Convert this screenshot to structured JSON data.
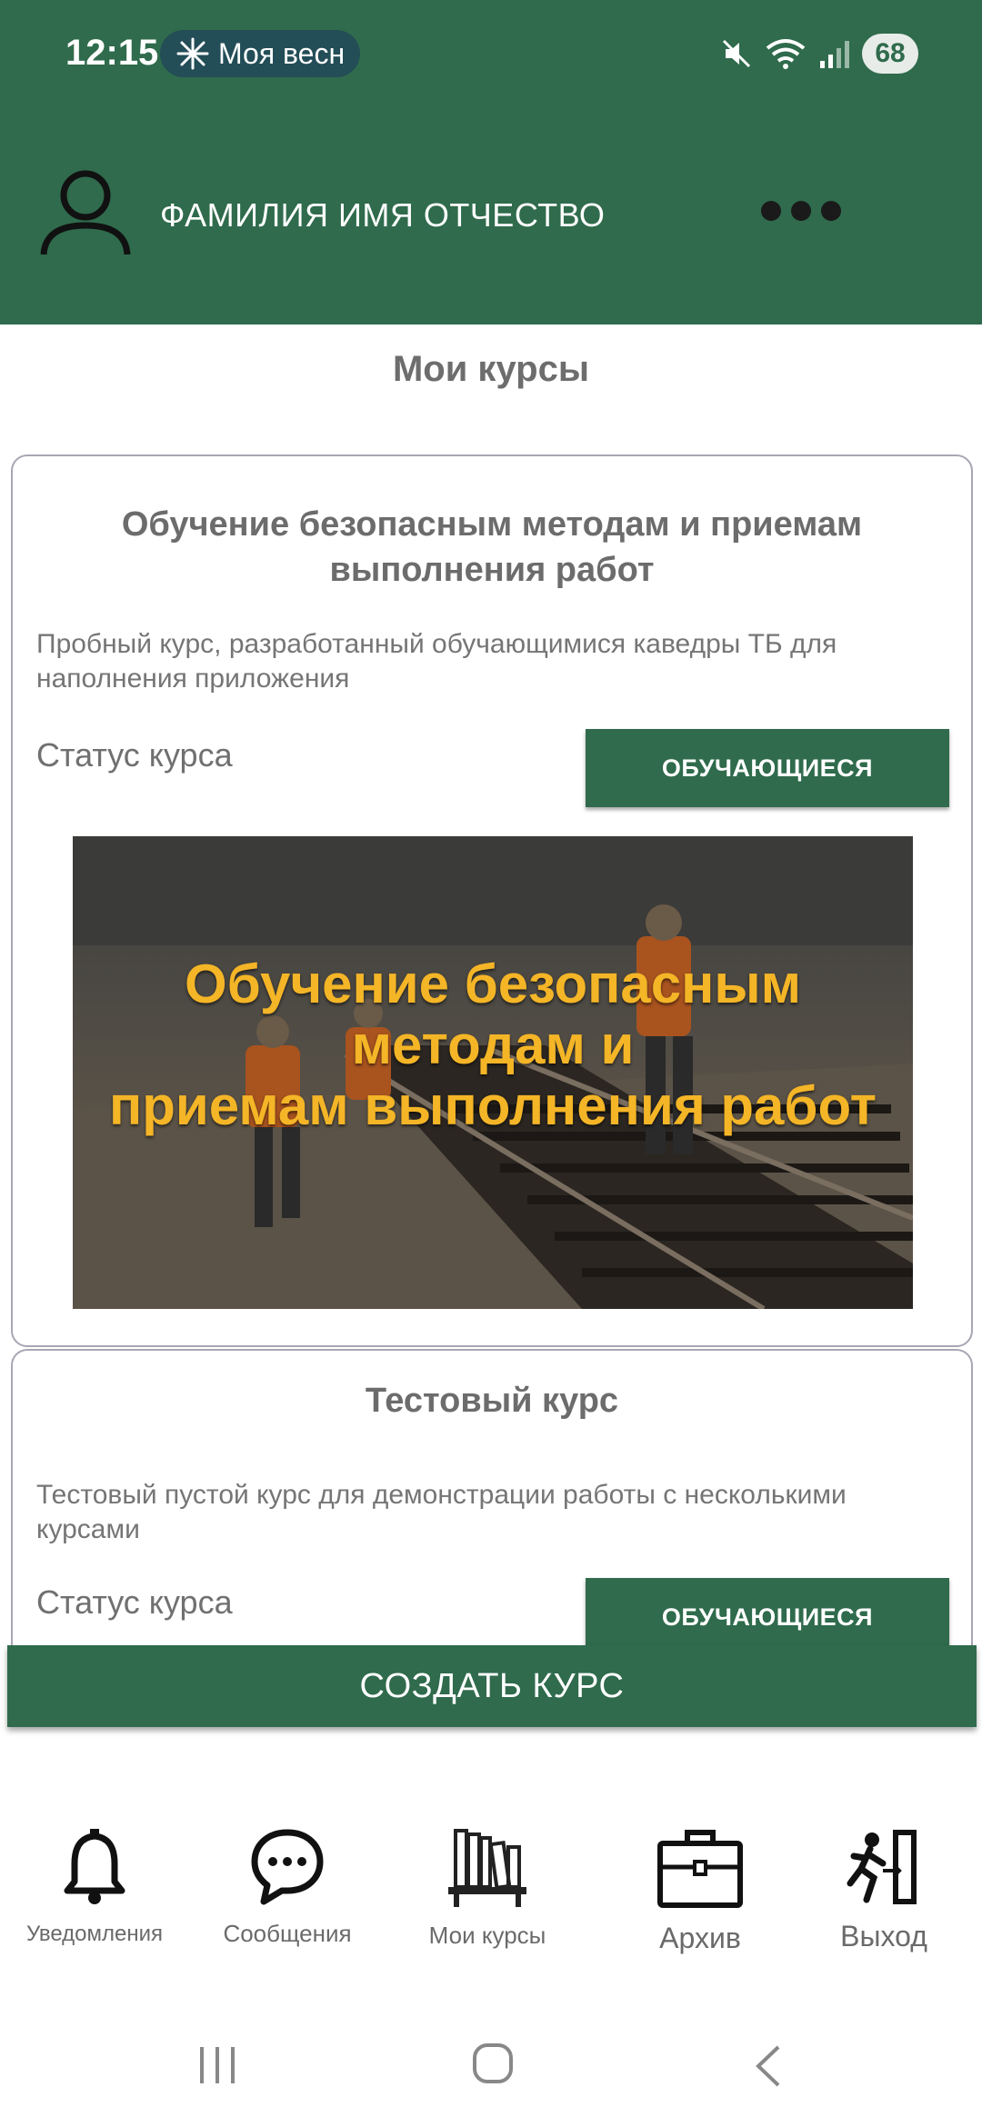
{
  "status_bar": {
    "time": "12:15",
    "notification_text": "Моя весн",
    "battery": "68"
  },
  "header": {
    "user_name": "ФАМИЛИЯ ИМЯ ОТЧЕСТВО"
  },
  "page": {
    "title": "Мои курсы"
  },
  "courses": [
    {
      "title": "Обучение безопасным методам и приемам выполнения работ",
      "description": "Пробный курс, разработанный обучающимися каведры ТБ для наполнения приложения",
      "status_label": "Статус курса",
      "status_button": "ОБУЧАЮЩИЕСЯ",
      "image_text": [
        "Обучение безопасным",
        "методам и",
        "приемам выполнения работ"
      ]
    },
    {
      "title": "Тестовый курс",
      "description": "Тестовый пустой курс для демонстрации работы с несколькими курсами",
      "status_label": "Статус курса",
      "status_button": "ОБУЧАЮЩИЕСЯ"
    }
  ],
  "create_button": "СОЗДАТЬ КУРС",
  "bottom_nav": [
    {
      "label": "Уведомления",
      "icon": "bell-icon"
    },
    {
      "label": "Сообщения",
      "icon": "chat-icon"
    },
    {
      "label": "Мои курсы",
      "icon": "bookshelf-icon"
    },
    {
      "label": "Архив",
      "icon": "briefcase-icon"
    },
    {
      "label": "Выход",
      "icon": "exit-icon"
    }
  ],
  "colors": {
    "primary": "#2f6b4c",
    "banner_text": "#f4b527"
  }
}
